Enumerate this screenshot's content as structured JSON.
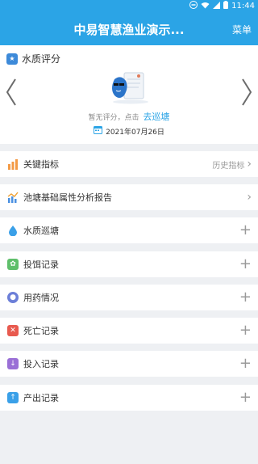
{
  "status_bar": {
    "time": "11:44"
  },
  "header": {
    "title": "中易智慧渔业演示...",
    "menu_label": "菜单"
  },
  "water_quality": {
    "section_title": "水质评分",
    "no_score_text": "暂无评分，点击",
    "go_patrol_link": "去巡塘",
    "date": "2021年07月26日"
  },
  "list": [
    {
      "label": "关键指标",
      "right_text": "历史指标",
      "right_icon": "chevron"
    },
    {
      "label": "池塘基础属性分析报告",
      "right_text": "",
      "right_icon": "chevron"
    },
    {
      "label": "水质巡塘",
      "right_text": "",
      "right_icon": "plus"
    },
    {
      "label": "投饵记录",
      "right_text": "",
      "right_icon": "plus"
    },
    {
      "label": "用药情况",
      "right_text": "",
      "right_icon": "plus"
    },
    {
      "label": "死亡记录",
      "right_text": "",
      "right_icon": "plus"
    },
    {
      "label": "投入记录",
      "right_text": "",
      "right_icon": "plus"
    },
    {
      "label": "产出记录",
      "right_text": "",
      "right_icon": "plus"
    }
  ],
  "colors": {
    "brand_blue": "#2ba4e6",
    "link_blue": "#2ba4e6",
    "background": "#eef0f3"
  }
}
